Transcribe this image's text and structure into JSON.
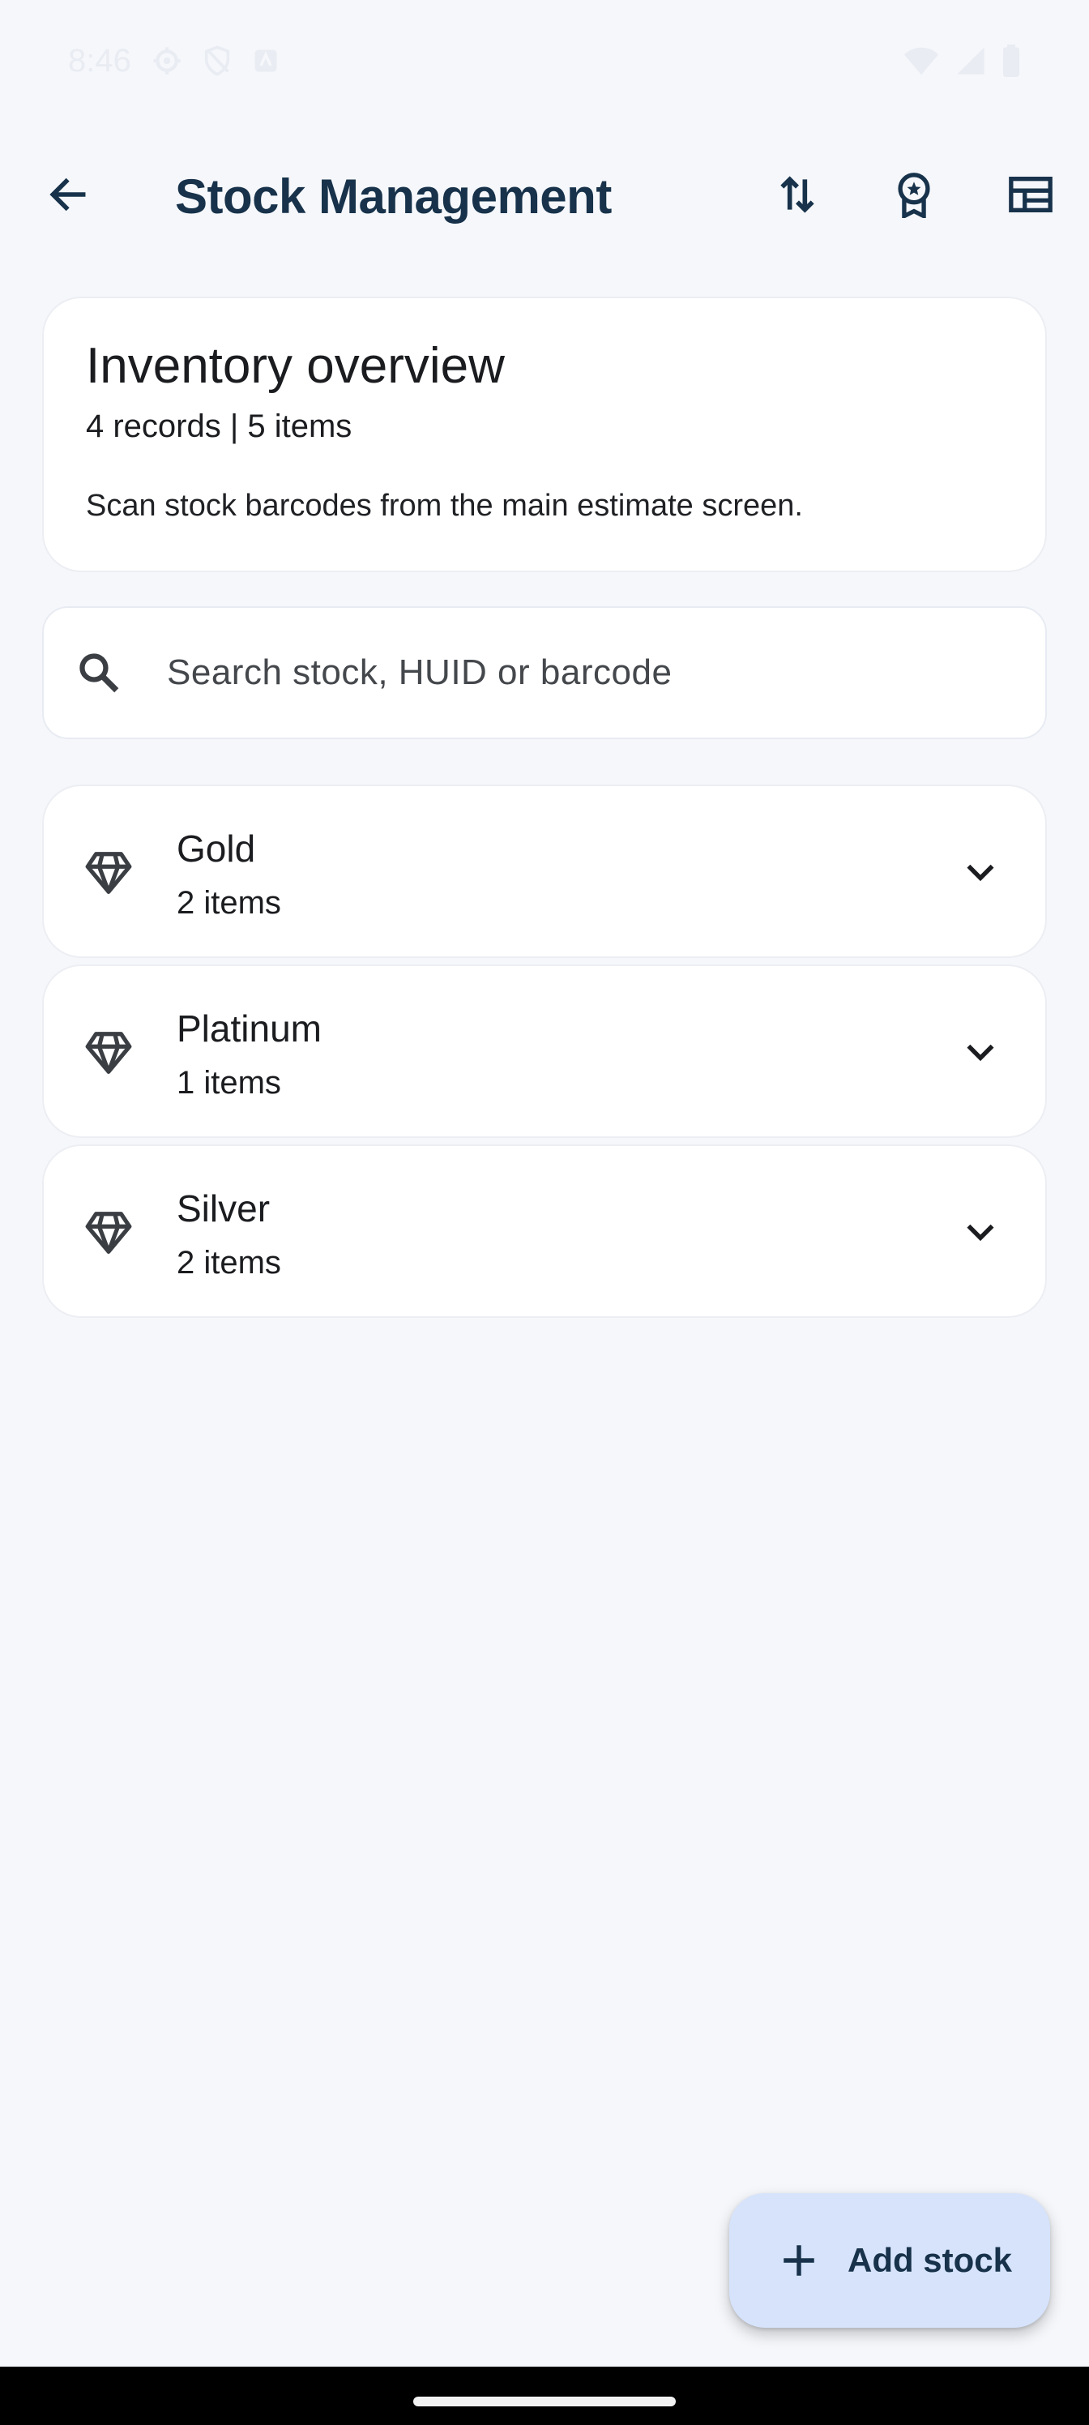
{
  "status_bar": {
    "time": "8:46",
    "icons_left": [
      "gear-icon",
      "shield-icon",
      "app-notification-icon"
    ],
    "icons_right": [
      "wifi-icon",
      "signal-icon",
      "battery-icon"
    ]
  },
  "app_bar": {
    "title": "Stock Management",
    "back_icon": "arrow-back-icon",
    "actions": [
      "sort-icon",
      "award-icon",
      "table-icon"
    ]
  },
  "overview": {
    "title": "Inventory overview",
    "summary": "4 records | 5 items",
    "note": "Scan stock barcodes from the main estimate screen."
  },
  "search": {
    "placeholder": "Search stock, HUID or barcode",
    "value": ""
  },
  "categories": [
    {
      "name": "Gold",
      "count": "2 items"
    },
    {
      "name": "Platinum",
      "count": "1 items"
    },
    {
      "name": "Silver",
      "count": "2 items"
    }
  ],
  "fab": {
    "label": "Add stock"
  },
  "colors": {
    "background": "#f5f7fb",
    "title": "#17324a",
    "fab_background": "#d6e3fb",
    "card": "#ffffff"
  }
}
